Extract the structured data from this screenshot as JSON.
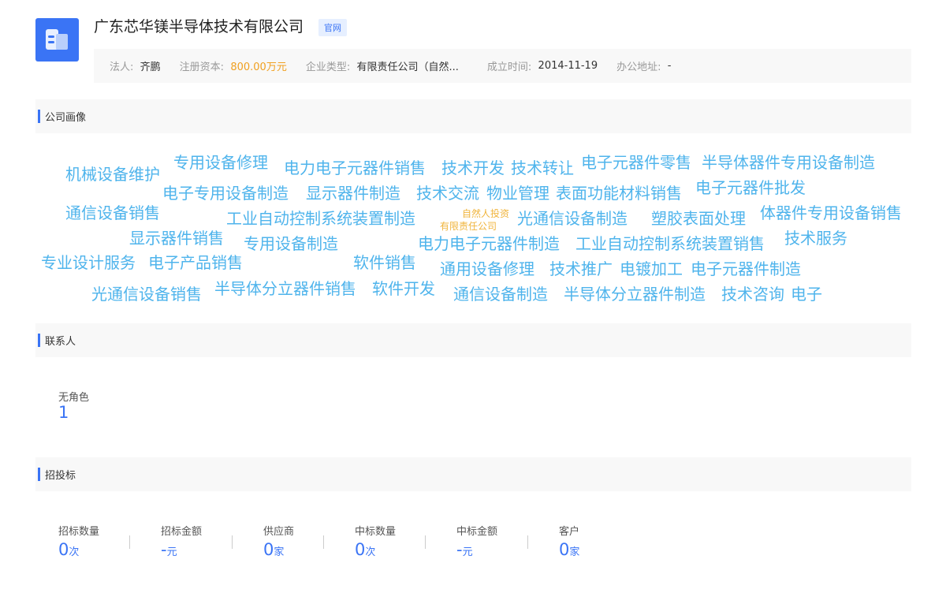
{
  "company": {
    "name": "广东芯华镁半导体技术有限公司",
    "site_tag": "官网",
    "info": {
      "legal_label": "法人:",
      "legal_value": "齐鹏",
      "capital_label": "注册资本:",
      "capital_value": "800.00万元",
      "type_label": "企业类型:",
      "type_value": "有限责任公司（自然...",
      "founded_label": "成立时间:",
      "founded_value": "2014-11-19",
      "address_label": "办公地址:",
      "address_value": "-"
    }
  },
  "sections": {
    "profile": "公司画像",
    "contacts": "联系人",
    "bidding": "招投标"
  },
  "word_cloud": {
    "tags": [
      "机械设备维护",
      "专用设备修理",
      "电力电子元器件销售",
      "技术开发",
      "技术转让",
      "电子元器件零售",
      "半导体器件专用设备制造",
      "电子专用设备制造",
      "显示器件制造",
      "技术交流",
      "物业管理",
      "表面功能材料销售",
      "电子元器件批发",
      "通信设备销售",
      "工业自动控制系统装置制造",
      "自然人投资",
      "有限责任公司",
      "光通信设备制造",
      "塑胶表面处理",
      "体器件专用设备销售",
      "显示器件销售",
      "专用设备制造",
      "电力电子元器件制造",
      "工业自动控制系统装置销售",
      "技术服务",
      "专业设计服务",
      "电子产品销售",
      "软件销售",
      "通用设备修理",
      "技术推广",
      "电镀加工",
      "电子元器件制造",
      "光通信设备销售",
      "半导体分立器件销售",
      "软件开发",
      "通信设备制造",
      "半导体分立器件制造",
      "技术咨询",
      "电子"
    ],
    "colors": {
      "primary": "#4fb4ec",
      "highlight": "#f0b43c"
    }
  },
  "contacts": {
    "role_label": "无角色",
    "role_count": "1"
  },
  "bidding": {
    "stats": [
      {
        "label": "招标数量",
        "value": "0",
        "unit": "次"
      },
      {
        "label": "招标金额",
        "value": "-",
        "unit": "元"
      },
      {
        "label": "供应商",
        "value": "0",
        "unit": "家"
      },
      {
        "label": "中标数量",
        "value": "0",
        "unit": "次"
      },
      {
        "label": "中标金额",
        "value": "-",
        "unit": "元"
      },
      {
        "label": "客户",
        "value": "0",
        "unit": "家"
      }
    ]
  },
  "colors": {
    "accent": "#3a74f5",
    "capital": "#f0a020"
  }
}
